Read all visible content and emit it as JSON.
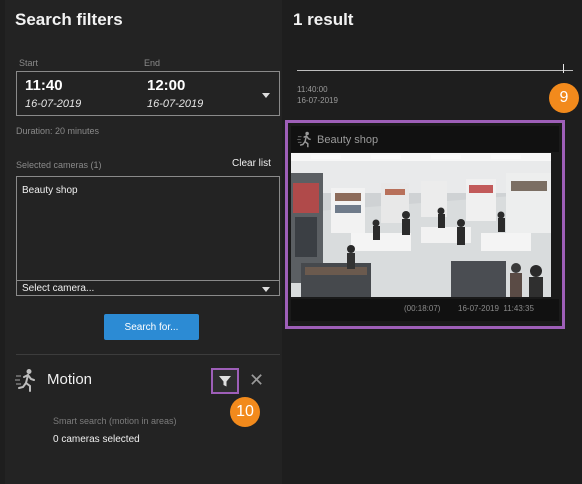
{
  "left": {
    "title": "Search filters",
    "start_label": "Start",
    "end_label": "End",
    "start_time": "11:40",
    "start_date": "16-07-2019",
    "end_time": "12:00",
    "end_date": "16-07-2019",
    "duration": "Duration: 20 minutes",
    "selected_cameras_label": "Selected cameras (1)",
    "clear_list": "Clear list",
    "camera_item": "Beauty shop",
    "select_camera": "Select camera...",
    "search_button": "Search for...",
    "motion_title": "Motion",
    "smart_search": "Smart search (motion in areas)",
    "cameras_selected": "0 cameras selected",
    "close_glyph": "✕"
  },
  "right": {
    "title": "1 result",
    "timeline_time": "11:40:00",
    "timeline_date": "16-07-2019",
    "card_camera": "Beauty shop",
    "card_duration": "(00:18:07)",
    "card_timestamp": "16-07-2019  11:43:35"
  },
  "badges": {
    "nine": "9",
    "ten": "10"
  },
  "icons": {
    "motion": "running-person-icon",
    "filter": "filter-funnel-icon",
    "close": "close-icon",
    "dropdown": "chevron-down-icon"
  },
  "colors": {
    "accent_blue": "#2c8bd4",
    "highlight_purple": "#9e5fb8",
    "badge_orange": "#f28a1c",
    "panel_bg": "#232323",
    "page_bg": "#1e1e1e"
  }
}
